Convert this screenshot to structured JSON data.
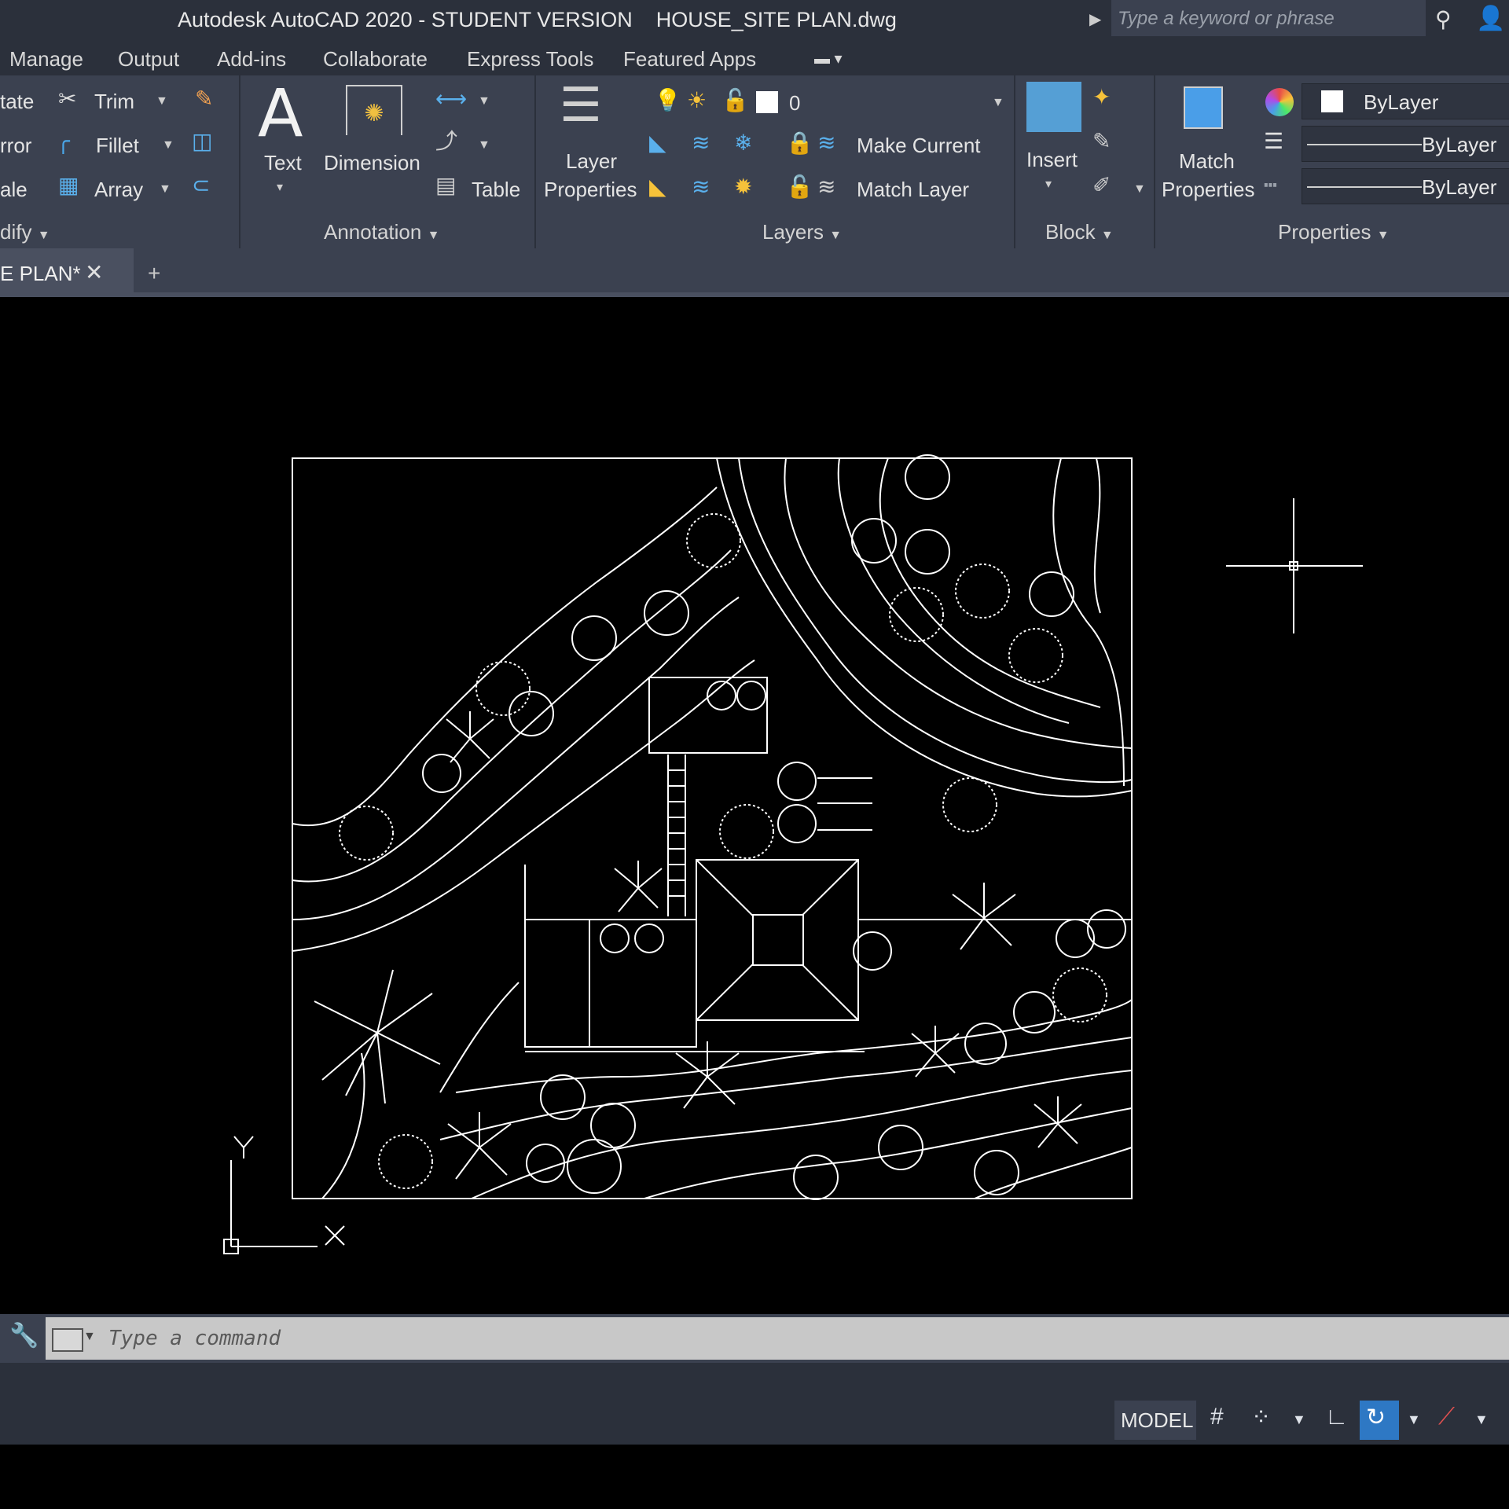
{
  "title_bar": {
    "title": "Autodesk AutoCAD 2020 - STUDENT VERSION    HOUSE_SITE PLAN.dwg",
    "search_placeholder": "Type a keyword or phrase"
  },
  "menu_tabs": [
    "Manage",
    "Output",
    "Add-ins",
    "Collaborate",
    "Express Tools",
    "Featured Apps"
  ],
  "ribbon": {
    "modify": {
      "rotate_label": "tate",
      "mirror_label": "rror",
      "scale_label": "ale",
      "trim_label": "Trim",
      "fillet_label": "Fillet",
      "array_label": "Array",
      "panel_title": "dify"
    },
    "annotation": {
      "text_label": "Text",
      "dimension_label": "Dimension",
      "table_label": "Table",
      "panel_title": "Annotation"
    },
    "layers": {
      "layer_properties_line1": "Layer",
      "layer_properties_line2": "Properties",
      "current_layer": "0",
      "make_current_label": "Make Current",
      "match_layer_label": "Match Layer",
      "panel_title": "Layers"
    },
    "block": {
      "insert_label": "Insert",
      "panel_title": "Block"
    },
    "properties": {
      "match_properties_line1": "Match",
      "match_properties_line2": "Properties",
      "color_value": "ByLayer",
      "lineweight_value": "ByLayer",
      "linetype_value": "ByLayer",
      "panel_title": "Properties"
    }
  },
  "document_tab": {
    "label": "E PLAN*"
  },
  "ucs": {
    "x_label": "X",
    "y_label": "Y"
  },
  "command_line": {
    "placeholder": "Type  a  command"
  },
  "status_bar": {
    "model_label": "MODEL"
  },
  "colors": {
    "title_bar": "#2b303b",
    "ribbon": "#3b4150",
    "canvas": "#000000",
    "drawing_lines": "#ffffff",
    "accent_blue": "#2e78c4"
  }
}
